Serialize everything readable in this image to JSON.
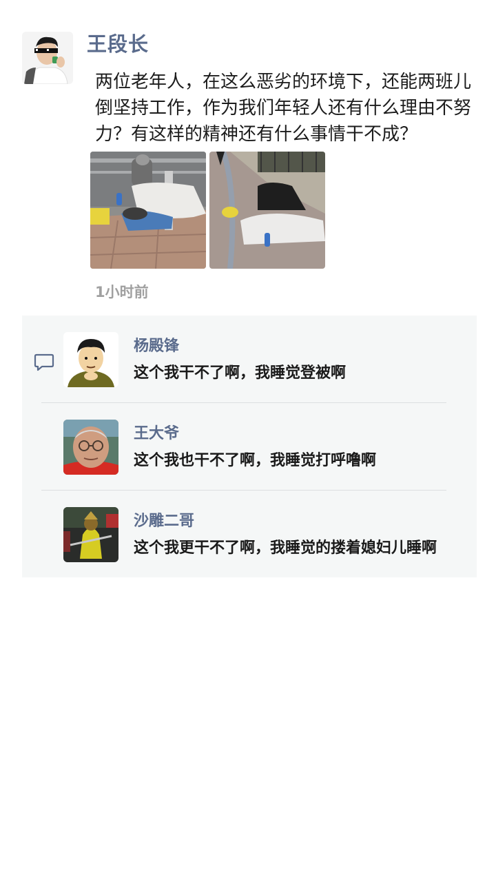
{
  "post": {
    "author": "王段长",
    "text": "两位老年人，在这么恶劣的环境下，还能两班儿倒坚持工作，作为我们年轻人还有什么理由不努力？有这样的精神还有什么事情干不成？",
    "time": "1小时前",
    "photos": [
      "photo-street-left",
      "photo-street-right"
    ]
  },
  "comments": [
    {
      "name": "杨殿锋",
      "text": "这个我干不了啊，我睡觉登被啊"
    },
    {
      "name": "王大爷",
      "text": "这个我也干不了啊，我睡觉打呼噜啊"
    },
    {
      "name": "沙雕二哥",
      "text": "这个我更干不了啊，我睡觉的搂着媳妇儿睡啊"
    }
  ],
  "colors": {
    "name": "#5a6b8c",
    "comments_bg": "#f5f7f7",
    "timestamp": "#a0a0a0"
  },
  "icons": {
    "comment": "speech-bubble-icon"
  }
}
